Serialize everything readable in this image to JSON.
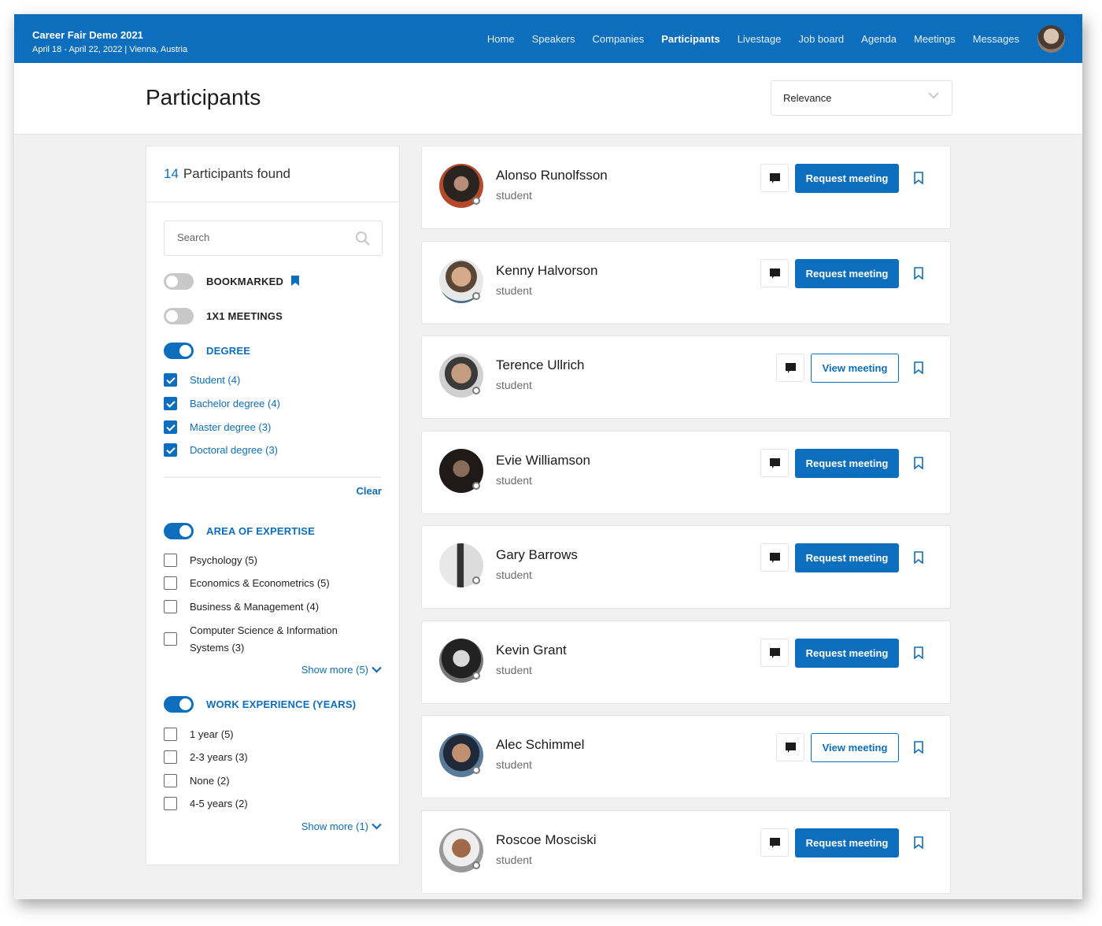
{
  "header": {
    "event_title": "Career Fair Demo 2021",
    "event_subtitle": "April 18 - April 22, 2022 | Vienna, Austria",
    "nav": [
      "Home",
      "Speakers",
      "Companies",
      "Participants",
      "Livestage",
      "Job board",
      "Agenda",
      "Meetings",
      "Messages"
    ],
    "active_nav": "Participants",
    "brand_color": "#0d6ebd"
  },
  "page": {
    "title": "Participants",
    "sort_value": "Relevance"
  },
  "sidebar": {
    "count": "14",
    "count_label": "Participants found",
    "search_placeholder": "Search",
    "bookmarked_label": "BOOKMARKED",
    "meetings_label": "1X1 MEETINGS",
    "degree": {
      "label": "DEGREE",
      "options": [
        "Student (4)",
        "Bachelor degree (4)",
        "Master degree (3)",
        "Doctoral degree (3)"
      ],
      "clear_label": "Clear"
    },
    "expertise": {
      "label": "AREA OF EXPERTISE",
      "options": [
        "Psychology (5)",
        "Economics & Econometrics (5)",
        "Business & Management (4)",
        "Computer Science & Information Systems (3)"
      ],
      "show_more": "Show more (5)"
    },
    "experience": {
      "label": "WORK EXPERIENCE (YEARS)",
      "options": [
        "1 year (5)",
        "2-3 years (3)",
        "None (2)",
        "4-5 years (2)"
      ],
      "show_more": "Show more (1)"
    }
  },
  "participants": [
    {
      "name": "Alonso Runolfsson",
      "role": "student",
      "action": "Request meeting"
    },
    {
      "name": "Kenny Halvorson",
      "role": "student",
      "action": "Request meeting"
    },
    {
      "name": "Terence Ullrich",
      "role": "student",
      "action": "View meeting"
    },
    {
      "name": "Evie Williamson",
      "role": "student",
      "action": "Request meeting"
    },
    {
      "name": "Gary Barrows",
      "role": "student",
      "action": "Request meeting"
    },
    {
      "name": "Kevin Grant",
      "role": "student",
      "action": "Request meeting"
    },
    {
      "name": "Alec Schimmel",
      "role": "student",
      "action": "View meeting"
    },
    {
      "name": "Roscoe Mosciski",
      "role": "student",
      "action": "Request meeting"
    }
  ]
}
